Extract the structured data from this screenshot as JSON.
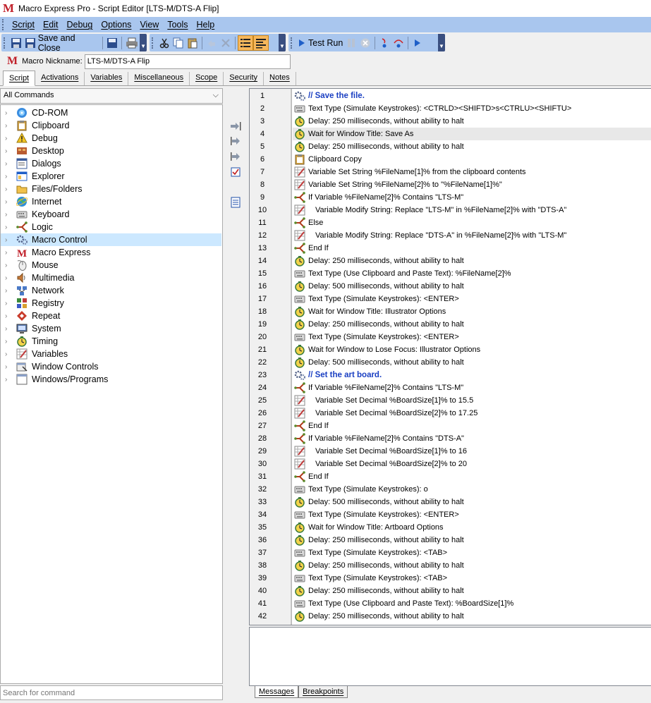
{
  "window": {
    "title": "Macro Express Pro - Script Editor [LTS-M/DTS-A Flip]",
    "logo": "M"
  },
  "menu": [
    "Script",
    "Edit",
    "Debug",
    "Options",
    "View",
    "Tools",
    "Help"
  ],
  "toolbar": {
    "save_close_label": "Save and Close",
    "test_run_label": "Test Run"
  },
  "nickname": {
    "label": "Macro Nickname:",
    "value": "LTS-M/DTS-A Flip"
  },
  "tabs": [
    {
      "label": "Script",
      "active": true
    },
    {
      "label": "Activations"
    },
    {
      "label": "Variables"
    },
    {
      "label": "Miscellaneous"
    },
    {
      "label": "Scope"
    },
    {
      "label": "Security"
    },
    {
      "label": "Notes"
    }
  ],
  "commands": {
    "dropdown": "All Commands",
    "search_placeholder": "Search for command",
    "items": [
      {
        "label": "CD-ROM",
        "icon": "cdrom-icon"
      },
      {
        "label": "Clipboard",
        "icon": "clipboard-icon"
      },
      {
        "label": "Debug",
        "icon": "debug-icon"
      },
      {
        "label": "Desktop",
        "icon": "desktop-icon"
      },
      {
        "label": "Dialogs",
        "icon": "dialogs-icon"
      },
      {
        "label": "Explorer",
        "icon": "explorer-icon"
      },
      {
        "label": "Files/Folders",
        "icon": "folder-icon"
      },
      {
        "label": "Internet",
        "icon": "internet-icon"
      },
      {
        "label": "Keyboard",
        "icon": "keyboard-icon"
      },
      {
        "label": "Logic",
        "icon": "logic-icon"
      },
      {
        "label": "Macro Control",
        "icon": "macro-control-icon",
        "selected": true
      },
      {
        "label": "Macro Express",
        "icon": "macro-express-icon"
      },
      {
        "label": "Mouse",
        "icon": "mouse-icon"
      },
      {
        "label": "Multimedia",
        "icon": "multimedia-icon"
      },
      {
        "label": "Network",
        "icon": "network-icon"
      },
      {
        "label": "Registry",
        "icon": "registry-icon"
      },
      {
        "label": "Repeat",
        "icon": "repeat-icon"
      },
      {
        "label": "System",
        "icon": "system-icon"
      },
      {
        "label": "Timing",
        "icon": "timing-icon"
      },
      {
        "label": "Variables",
        "icon": "variables-icon"
      },
      {
        "label": "Window Controls",
        "icon": "window-controls-icon"
      },
      {
        "label": "Windows/Programs",
        "icon": "windows-programs-icon"
      }
    ]
  },
  "script": [
    {
      "num": "1",
      "text": "// Save the file.",
      "icon": "macro-control",
      "comment": true
    },
    {
      "num": "2",
      "text": "Text Type (Simulate Keystrokes): <CTRLD><SHIFTD>s<CTRLU><SHIFTU>",
      "icon": "keyboard"
    },
    {
      "num": "3",
      "text": "Delay: 250 milliseconds, without ability to halt",
      "icon": "timing"
    },
    {
      "num": "4",
      "text": "Wait for Window Title: Save As",
      "icon": "timing",
      "highlight": true
    },
    {
      "num": "5",
      "text": "Delay: 250 milliseconds, without ability to halt",
      "icon": "timing"
    },
    {
      "num": "6",
      "text": "Clipboard Copy",
      "icon": "clipboard"
    },
    {
      "num": "7",
      "text": "Variable Set String %FileName[1]% from the clipboard contents",
      "icon": "variables"
    },
    {
      "num": "8",
      "text": "Variable Set String %FileName[2]% to \"%FileName[1]%\"",
      "icon": "variables"
    },
    {
      "num": "9",
      "text": "If Variable %FileName[2]% Contains \"LTS-M\"",
      "icon": "logic"
    },
    {
      "num": "10",
      "text": "Variable Modify String: Replace \"LTS-M\" in %FileName[2]% with \"DTS-A\"",
      "icon": "variables",
      "indent": true
    },
    {
      "num": "11",
      "text": "Else",
      "icon": "logic"
    },
    {
      "num": "12",
      "text": "Variable Modify String: Replace \"DTS-A\" in %FileName[2]% with \"LTS-M\"",
      "icon": "variables",
      "indent": true
    },
    {
      "num": "13",
      "text": "End If",
      "icon": "logic"
    },
    {
      "num": "14",
      "text": "Delay: 250 milliseconds, without ability to halt",
      "icon": "timing"
    },
    {
      "num": "15",
      "text": "Text Type (Use Clipboard and Paste Text): %FileName[2]%",
      "icon": "keyboard"
    },
    {
      "num": "16",
      "text": "Delay: 500 milliseconds, without ability to halt",
      "icon": "timing"
    },
    {
      "num": "17",
      "text": "Text Type (Simulate Keystrokes): <ENTER>",
      "icon": "keyboard"
    },
    {
      "num": "18",
      "text": "Wait for Window Title: Illustrator Options",
      "icon": "timing"
    },
    {
      "num": "19",
      "text": "Delay: 250 milliseconds, without ability to halt",
      "icon": "timing"
    },
    {
      "num": "20",
      "text": "Text Type (Simulate Keystrokes): <ENTER>",
      "icon": "keyboard"
    },
    {
      "num": "21",
      "text": "Wait for Window to Lose Focus: Illustrator Options",
      "icon": "timing"
    },
    {
      "num": "22",
      "text": "Delay: 500 milliseconds, without ability to halt",
      "icon": "timing"
    },
    {
      "num": "23",
      "text": "// Set the art board.",
      "icon": "macro-control",
      "comment": true
    },
    {
      "num": "24",
      "text": "If Variable %FileName[2]% Contains \"LTS-M\"",
      "icon": "logic"
    },
    {
      "num": "25",
      "text": "Variable Set Decimal %BoardSize[1]% to 15.5",
      "icon": "variables",
      "indent": true
    },
    {
      "num": "26",
      "text": "Variable Set Decimal %BoardSize[2]% to 17.25",
      "icon": "variables",
      "indent": true
    },
    {
      "num": "27",
      "text": "End If",
      "icon": "logic"
    },
    {
      "num": "28",
      "text": "If Variable %FileName[2]% Contains \"DTS-A\"",
      "icon": "logic"
    },
    {
      "num": "29",
      "text": "Variable Set Decimal %BoardSize[1]% to 16",
      "icon": "variables",
      "indent": true
    },
    {
      "num": "30",
      "text": "Variable Set Decimal %BoardSize[2]% to 20",
      "icon": "variables",
      "indent": true
    },
    {
      "num": "31",
      "text": "End If",
      "icon": "logic"
    },
    {
      "num": "32",
      "text": "Text Type (Simulate Keystrokes): o",
      "icon": "keyboard"
    },
    {
      "num": "33",
      "text": "Delay: 500 milliseconds, without ability to halt",
      "icon": "timing"
    },
    {
      "num": "34",
      "text": "Text Type (Simulate Keystrokes): <ENTER>",
      "icon": "keyboard"
    },
    {
      "num": "35",
      "text": "Wait for Window Title: Artboard Options",
      "icon": "timing"
    },
    {
      "num": "36",
      "text": "Delay: 250 milliseconds, without ability to halt",
      "icon": "timing"
    },
    {
      "num": "37",
      "text": "Text Type (Simulate Keystrokes): <TAB>",
      "icon": "keyboard"
    },
    {
      "num": "38",
      "text": "Delay: 250 milliseconds, without ability to halt",
      "icon": "timing"
    },
    {
      "num": "39",
      "text": "Text Type (Simulate Keystrokes): <TAB>",
      "icon": "keyboard"
    },
    {
      "num": "40",
      "text": "Delay: 250 milliseconds, without ability to halt",
      "icon": "timing"
    },
    {
      "num": "41",
      "text": "Text Type (Use Clipboard and Paste Text): %BoardSize[1]%",
      "icon": "keyboard"
    },
    {
      "num": "42",
      "text": "Delay: 250 milliseconds, without ability to halt",
      "icon": "timing"
    }
  ],
  "bottom_tabs": [
    {
      "label": "Messages",
      "active": true
    },
    {
      "label": "Breakpoints"
    }
  ],
  "colors": {
    "toolbar_blue": "#a9c6ee",
    "comment_blue": "#1a3fc2",
    "selected_bg": "#cce8ff",
    "active_button": "#f6b75b"
  }
}
